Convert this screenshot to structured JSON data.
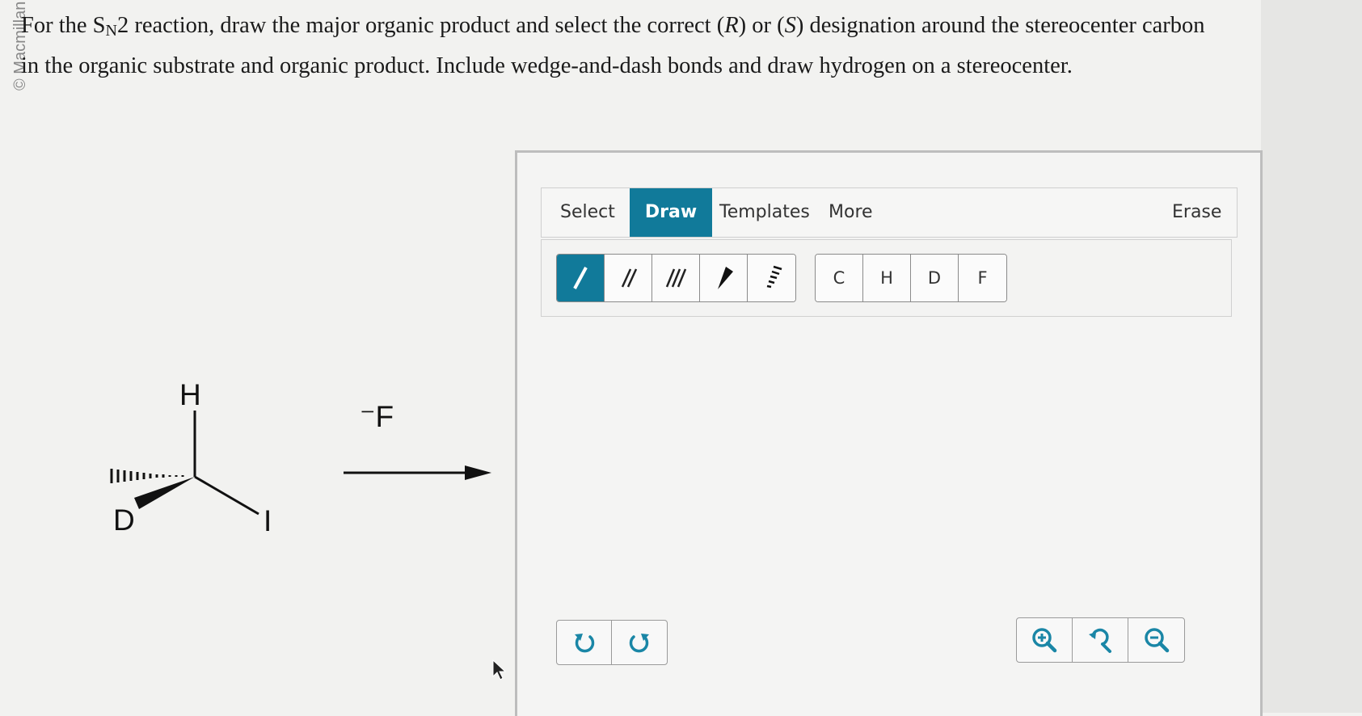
{
  "watermark": "© Macmillan",
  "question": {
    "p1": "For the S",
    "sub": "N",
    "p2": "2 reaction, draw the major organic product and select the correct (",
    "R": "R",
    "p3": ") or (",
    "S": "S",
    "p4": ") designation around the stereocenter carbon in the organic substrate and organic product. Include wedge-and-dash bonds and draw hydrogen on a stereocenter."
  },
  "substrate": {
    "atom_h": "H",
    "atom_d": "D",
    "atom_i": "I"
  },
  "reagent": "⁻F",
  "editor": {
    "menu": {
      "select": "Select",
      "draw": "Draw",
      "templates": "Templates",
      "more": "More",
      "erase": "Erase"
    },
    "atoms": [
      "C",
      "H",
      "D",
      "F"
    ],
    "bond_tools": [
      "single-bond-icon",
      "double-bond-icon",
      "triple-bond-icon",
      "wedge-bond-icon",
      "dash-bond-icon"
    ],
    "active_color": "#117a9a"
  }
}
